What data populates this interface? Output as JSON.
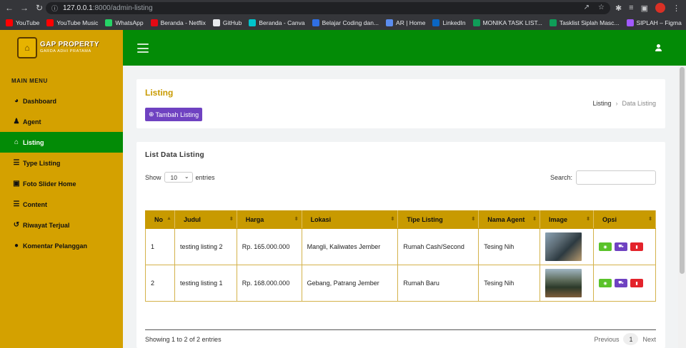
{
  "browser": {
    "url_host": "127.0.0.1",
    "url_path": ":8000/admin-listing",
    "bookmarks": [
      {
        "label": "YouTube",
        "color": "#ff0000"
      },
      {
        "label": "YouTube Music",
        "color": "#ff0000"
      },
      {
        "label": "WhatsApp",
        "color": "#25d366"
      },
      {
        "label": "Beranda - Netflix",
        "color": "#e50914"
      },
      {
        "label": "GitHub",
        "color": "#e8eaed"
      },
      {
        "label": "Beranda - Canva",
        "color": "#00c4cc"
      },
      {
        "label": "Belajar Coding dan...",
        "color": "#2f6fe4"
      },
      {
        "label": "AR | Home",
        "color": "#5b8def"
      },
      {
        "label": "LinkedIn",
        "color": "#0a66c2"
      },
      {
        "label": "MONIKA TASK LIST...",
        "color": "#0f9d58"
      },
      {
        "label": "Tasklist Siplah Masc...",
        "color": "#0f9d58"
      },
      {
        "label": "SIPLAH – Figma",
        "color": "#a259ff"
      }
    ]
  },
  "brand": {
    "name": "GAP PROPERTY",
    "tagline": "GARDA ADHI PRATAMA",
    "header_color": "#038b06",
    "sidebar_color": "#d4a100"
  },
  "sidebar": {
    "title": "MAIN MENU",
    "items": [
      {
        "label": "Dashboard",
        "icon": "tachometer-icon"
      },
      {
        "label": "Agent",
        "icon": "user-icon"
      },
      {
        "label": "Listing",
        "icon": "home-icon",
        "active": true
      },
      {
        "label": "Type Listing",
        "icon": "list-icon"
      },
      {
        "label": "Foto Slider Home",
        "icon": "image-icon"
      },
      {
        "label": "Content",
        "icon": "list-icon"
      },
      {
        "label": "Riwayat Terjual",
        "icon": "history-icon"
      },
      {
        "label": "Komentar Pelanggan",
        "icon": "comment-icon"
      }
    ]
  },
  "page": {
    "title": "Listing",
    "add_button": "Tambah Listing",
    "breadcrumb": [
      "Listing",
      "Data Listing"
    ]
  },
  "list": {
    "title": "List Data Listing",
    "show_label": "Show",
    "entries_value": "10",
    "entries_label": "entries",
    "search_label": "Search:",
    "columns": [
      "No",
      "Judul",
      "Harga",
      "Lokasi",
      "Tipe Listing",
      "Nama Agent",
      "Image",
      "Opsi"
    ],
    "rows": [
      {
        "no": "1",
        "judul": "testing listing 2",
        "harga": "Rp. 165.000.000",
        "lokasi": "Mangli, Kaliwates Jember",
        "tipe": "Rumah Cash/Second",
        "agent": "Tesing Nih"
      },
      {
        "no": "2",
        "judul": "testing listing 1",
        "harga": "Rp. 168.000.000",
        "lokasi": "Gebang, Patrang Jember",
        "tipe": "Rumah Baru",
        "agent": "Tesing Nih"
      }
    ],
    "info": "Showing 1 to 2 of 2 entries",
    "pager": {
      "previous": "Previous",
      "current": "1",
      "next": "Next"
    }
  }
}
